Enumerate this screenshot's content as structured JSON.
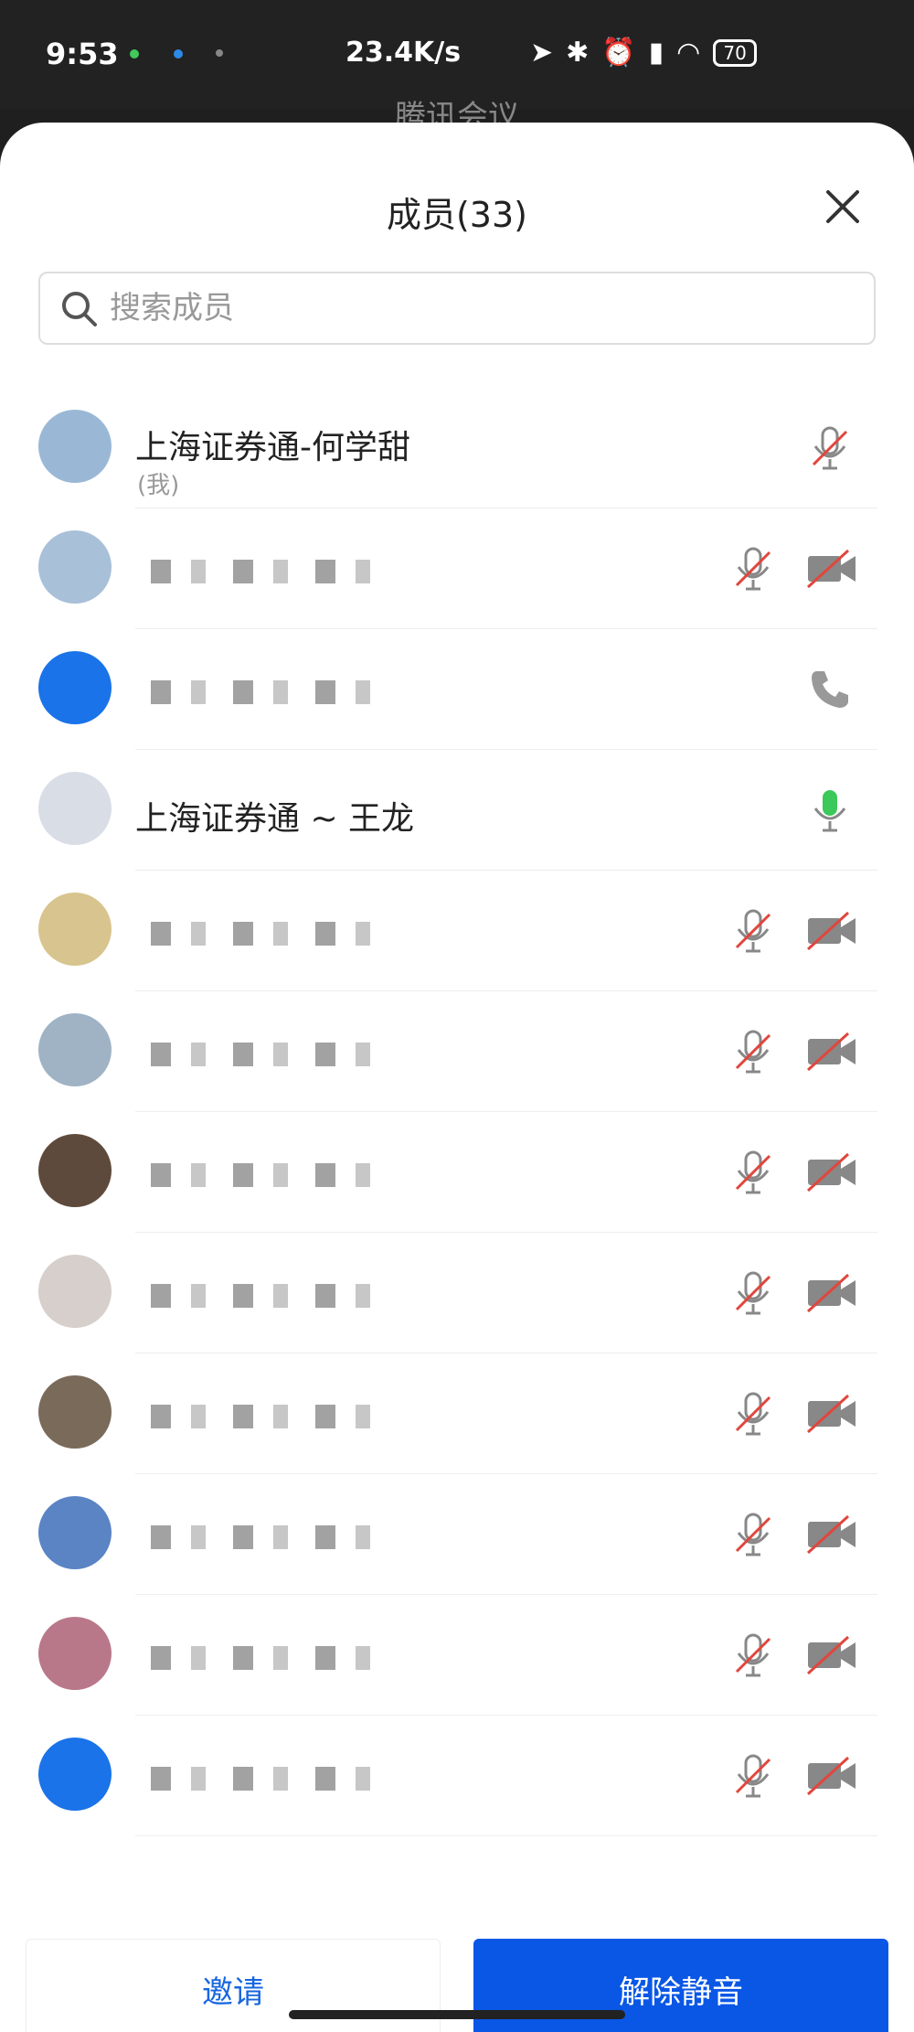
{
  "status_bar": {
    "time": "9:53",
    "net_speed": "23.4K/s",
    "battery": "70",
    "icons": [
      "location-icon",
      "bluetooth-icon",
      "alarm-icon",
      "signal-icon",
      "wifi-icon",
      "battery-icon"
    ]
  },
  "behind_title": "腾讯会议",
  "sheet": {
    "title": "成员(33)",
    "search_placeholder": "搜索成员"
  },
  "members": [
    {
      "name": "上海证券通-何学甜",
      "sub": "(我)",
      "mic": "muted",
      "cam": "none",
      "avatar_color": "#9ab8d6"
    },
    {
      "name": "",
      "sub": "",
      "mic": "muted",
      "cam": "off",
      "avatar_color": "#a8c0d8",
      "blurred": true
    },
    {
      "name": "",
      "sub": "",
      "mic": "phone",
      "cam": "none",
      "avatar_color": "#1a73e8",
      "blurred": true
    },
    {
      "name": "上海证券通 ~ 王龙",
      "sub": "",
      "mic": "active",
      "cam": "none",
      "avatar_color": "#d9dde6"
    },
    {
      "name": "",
      "sub": "",
      "mic": "muted",
      "cam": "off",
      "avatar_color": "#d8c48e",
      "blurred": true
    },
    {
      "name": "",
      "sub": "",
      "mic": "muted",
      "cam": "off",
      "avatar_color": "#9fb3c4",
      "blurred": true
    },
    {
      "name": "",
      "sub": "",
      "mic": "muted",
      "cam": "off",
      "avatar_color": "#5e4a3c",
      "blurred": true
    },
    {
      "name": "",
      "sub": "",
      "mic": "muted",
      "cam": "off",
      "avatar_color": "#d6cfcb",
      "blurred": true
    },
    {
      "name": "",
      "sub": "",
      "mic": "muted",
      "cam": "off",
      "avatar_color": "#7a6a5a",
      "blurred": true
    },
    {
      "name": "",
      "sub": "",
      "mic": "muted",
      "cam": "off",
      "avatar_color": "#5a84c4",
      "blurred": true
    },
    {
      "name": "",
      "sub": "",
      "mic": "muted",
      "cam": "off",
      "avatar_color": "#b9788a",
      "blurred": true
    },
    {
      "name": "",
      "sub": "",
      "mic": "muted",
      "cam": "off",
      "avatar_color": "#1a73e8",
      "blurred": true
    }
  ],
  "buttons": {
    "invite": "邀请",
    "unmute": "解除静音"
  },
  "colors": {
    "primary": "#0a57e6",
    "muted_red": "#e0463d",
    "active_green": "#3cc85a"
  }
}
